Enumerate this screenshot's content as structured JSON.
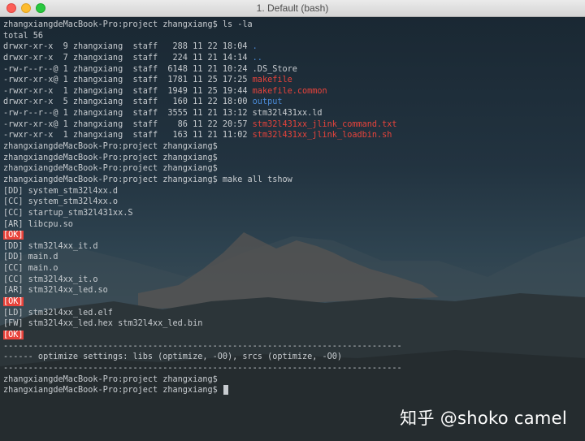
{
  "window": {
    "title": "1. Default (bash)"
  },
  "colors": {
    "directory": "#4a8ad6",
    "executable": "#e8433b",
    "text": "#c8ccd0"
  },
  "terminal": {
    "lines": [
      {
        "text": "zhangxiangdeMacBook-Pro:project zhangxiang$ ls -la"
      },
      {
        "text": "total 56"
      },
      {
        "prefix": "drwxr-xr-x  9 zhangxiang  staff   288 11 22 18:04 ",
        "name": ".",
        "kind": "dir"
      },
      {
        "prefix": "drwxr-xr-x  7 zhangxiang  staff   224 11 21 14:14 ",
        "name": "..",
        "kind": "dir"
      },
      {
        "prefix": "-rw-r--r--@ 1 zhangxiang  staff  6148 11 21 10:24 ",
        "name": ".DS_Store",
        "kind": "file"
      },
      {
        "prefix": "-rwxr-xr-x@ 1 zhangxiang  staff  1781 11 25 17:25 ",
        "name": "makefile",
        "kind": "exe"
      },
      {
        "prefix": "-rwxr-xr-x  1 zhangxiang  staff  1949 11 25 19:44 ",
        "name": "makefile.common",
        "kind": "exe"
      },
      {
        "prefix": "drwxr-xr-x  5 zhangxiang  staff   160 11 22 18:00 ",
        "name": "output",
        "kind": "dir"
      },
      {
        "prefix": "-rw-r--r--@ 1 zhangxiang  staff  3555 11 21 13:12 ",
        "name": "stm32l431xx.ld",
        "kind": "file"
      },
      {
        "prefix": "-rwxr-xr-x@ 1 zhangxiang  staff    86 11 22 20:57 ",
        "name": "stm32l431xx_jlink_command.txt",
        "kind": "exe"
      },
      {
        "prefix": "-rwxr-xr-x  1 zhangxiang  staff   163 11 21 11:02 ",
        "name": "stm32l431xx_jlink_loadbin.sh",
        "kind": "exe"
      },
      {
        "text": "zhangxiangdeMacBook-Pro:project zhangxiang$"
      },
      {
        "text": "zhangxiangdeMacBook-Pro:project zhangxiang$"
      },
      {
        "text": "zhangxiangdeMacBook-Pro:project zhangxiang$"
      },
      {
        "text": "zhangxiangdeMacBook-Pro:project zhangxiang$ make all tshow"
      },
      {
        "text": "[DD] system_stm32l4xx.d"
      },
      {
        "text": "[CC] system_stm32l4xx.o"
      },
      {
        "text": "[CC] startup_stm32l431xx.S"
      },
      {
        "text": "[AR] libcpu.so"
      },
      {
        "ok": "[OK]"
      },
      {
        "text": "[DD] stm32l4xx_it.d"
      },
      {
        "text": "[DD] main.d"
      },
      {
        "text": "[CC] main.o"
      },
      {
        "text": "[CC] stm32l4xx_it.o"
      },
      {
        "text": "[AR] stm32l4xx_led.so"
      },
      {
        "ok": "[OK]"
      },
      {
        "text": "[LD] stm32l4xx_led.elf"
      },
      {
        "text": "[FW] stm32l4xx_led.hex stm32l4xx_led.bin"
      },
      {
        "ok": "[OK]"
      },
      {
        "text": "--------------------------------------------------------------------------------"
      },
      {
        "text": "------ optimize settings: libs (optimize, -O0), srcs (optimize, -O0)"
      },
      {
        "text": "--------------------------------------------------------------------------------"
      },
      {
        "text": "zhangxiangdeMacBook-Pro:project zhangxiang$"
      },
      {
        "text": "zhangxiangdeMacBook-Pro:project zhangxiang$ ",
        "cursor": true
      }
    ]
  },
  "watermark": "知乎 @shoko camel"
}
